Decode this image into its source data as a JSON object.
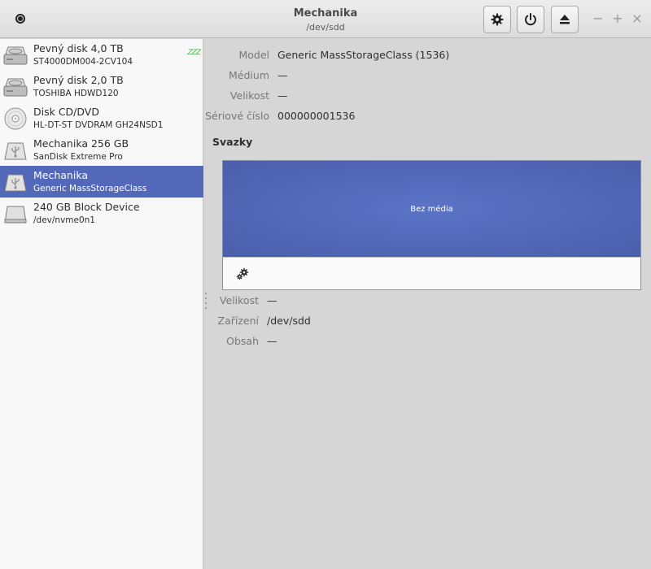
{
  "window": {
    "title": "Mechanika",
    "subtitle": "/dev/sdd"
  },
  "header_buttons": {
    "menu_icon": "app-menu-icon",
    "settings_icon": "gear-icon",
    "power_icon": "power-icon",
    "eject_icon": "eject-icon",
    "minimize": "−",
    "maximize": "+",
    "close": "×"
  },
  "sidebar": {
    "drives": [
      {
        "name": "Pevný disk 4,0 TB",
        "model": "ST4000DM004-2CV104",
        "icon": "hard-disk-icon",
        "status": "ZZZ",
        "selected": false
      },
      {
        "name": "Pevný disk 2,0 TB",
        "model": "TOSHIBA HDWD120",
        "icon": "hard-disk-icon",
        "selected": false
      },
      {
        "name": "Disk CD/DVD",
        "model": "HL-DT-ST DVDRAM GH24NSD1",
        "icon": "optical-disc-icon",
        "selected": false
      },
      {
        "name": "Mechanika 256 GB",
        "model": "SanDisk Extreme Pro",
        "icon": "usb-drive-icon",
        "selected": false
      },
      {
        "name": "Mechanika",
        "model": "Generic MassStorageClass",
        "icon": "usb-drive-icon",
        "selected": true
      },
      {
        "name": "240 GB Block Device",
        "model": "/dev/nvme0n1",
        "icon": "block-device-icon",
        "selected": false
      }
    ]
  },
  "details": {
    "model_label": "Model",
    "model_value": "Generic MassStorageClass (1536)",
    "medium_label": "Médium",
    "medium_value": "—",
    "size_label": "Velikost",
    "size_value": "—",
    "serial_label": "Sériové číslo",
    "serial_value": "000000001536"
  },
  "volumes": {
    "section_title": "Svazky",
    "volume_label": "Bez média",
    "toolbar_icon": "gears-icon",
    "volume_color": "#5468b9",
    "size_label": "Velikost",
    "size_value": "—",
    "device_label": "Zařízení",
    "device_value": "/dev/sdd",
    "content_label": "Obsah",
    "content_value": "—"
  }
}
